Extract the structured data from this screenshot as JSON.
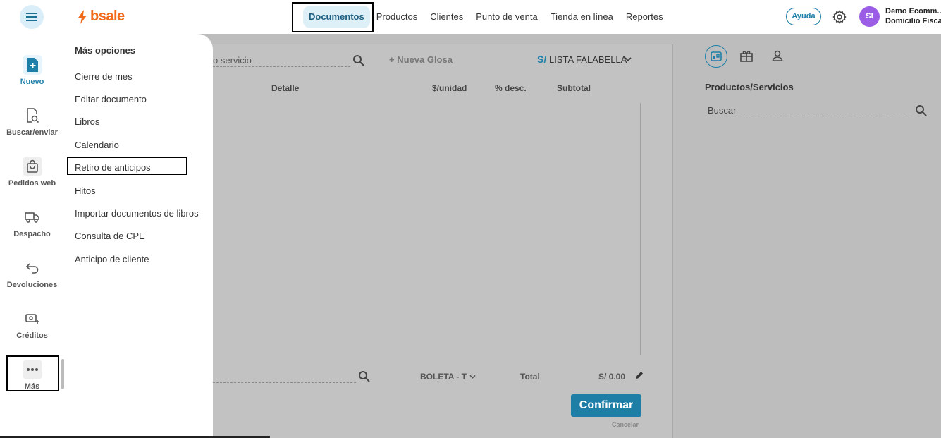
{
  "header": {
    "logo_text": "bsale",
    "nav": [
      "Documentos",
      "Productos",
      "Clientes",
      "Punto de venta",
      "Tienda en línea",
      "Reportes"
    ],
    "help_label": "Ayuda",
    "avatar_initials": "SI",
    "user_name": "Demo Ecomm...",
    "user_sub": "Domicilio Fisca"
  },
  "sidebar": {
    "items": [
      {
        "label": "Nuevo"
      },
      {
        "label": "Buscar/enviar"
      },
      {
        "label": "Pedidos web"
      },
      {
        "label": "Despacho"
      },
      {
        "label": "Devoluciones"
      },
      {
        "label": "Créditos"
      },
      {
        "label": "Más"
      }
    ]
  },
  "menu": {
    "title": "Más opciones",
    "items": [
      "Cierre de mes",
      "Editar documento",
      "Libros",
      "Calendario",
      "Retiro de anticipos",
      "Hitos",
      "Importar documentos de libros",
      "Consulta de CPE",
      "Anticipo de cliente"
    ]
  },
  "document": {
    "search_partial": "o servicio",
    "nueva_glosa": "+ Nueva Glosa",
    "price_list_prefix": "S/",
    "price_list": "LISTA FALABELLA",
    "columns": [
      "Detalle",
      "$/unidad",
      "% desc.",
      "Subtotal"
    ],
    "doc_type": "BOLETA - T",
    "total_label": "Total",
    "total_value": "S/ 0.00",
    "confirm_label": "Confirmar",
    "cancel_label": "Cancelar"
  },
  "products": {
    "title": "Productos/Servicios",
    "search_placeholder": "Buscar"
  }
}
